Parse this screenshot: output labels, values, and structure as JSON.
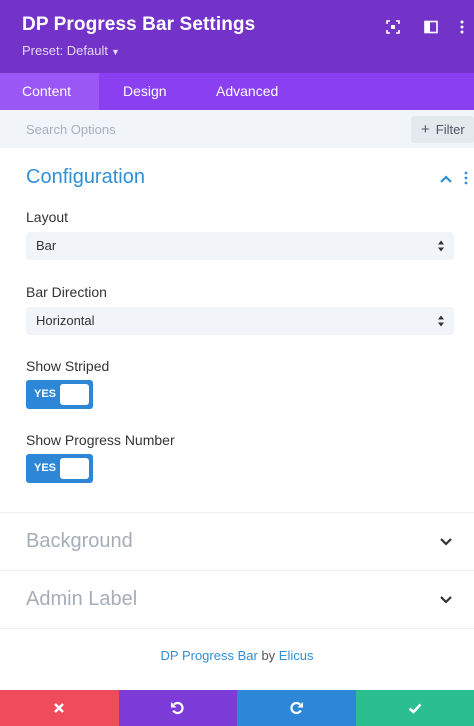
{
  "header": {
    "title": "DP Progress Bar Settings",
    "preset": "Preset: Default",
    "icons": [
      "expand-icon",
      "split-view-icon"
    ]
  },
  "tabs": [
    {
      "label": "Content",
      "active": true
    },
    {
      "label": "Design",
      "active": false
    },
    {
      "label": "Advanced",
      "active": false
    }
  ],
  "search": {
    "placeholder": "Search Options",
    "filter_label": "Filter"
  },
  "configuration": {
    "title": "Configuration",
    "layout": {
      "label": "Layout",
      "value": "Bar"
    },
    "bar_direction": {
      "label": "Bar Direction",
      "value": "Horizontal"
    },
    "show_striped": {
      "label": "Show Striped",
      "value": "YES"
    },
    "show_progress_number": {
      "label": "Show Progress Number",
      "value": "YES"
    }
  },
  "sections": {
    "background": "Background",
    "admin_label": "Admin Label"
  },
  "credit": {
    "module": "DP Progress Bar",
    "by": "by",
    "author": "Elicus"
  },
  "colors": {
    "header": "#7433c8",
    "tabs": "#8a3ff0",
    "accent": "#2e90d6",
    "cancel": "#ef4b5b",
    "undo": "#7d3bd8",
    "redo": "#2e86d6",
    "save": "#2bbf8f"
  }
}
